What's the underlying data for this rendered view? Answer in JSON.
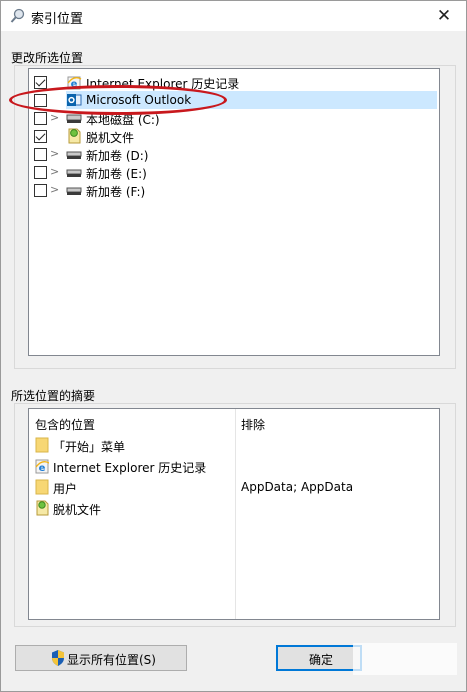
{
  "window": {
    "title": "索引位置",
    "title_icon": "indexing-options-icon",
    "close_glyph": "✕"
  },
  "change_locations": {
    "group_label": "更改所选位置",
    "items": [
      {
        "label": "Internet Explorer 历史记录",
        "checked": true,
        "expandable": false,
        "icon": "internet-explorer-icon"
      },
      {
        "label": "Microsoft Outlook",
        "checked": false,
        "expandable": false,
        "icon": "outlook-icon",
        "selected": true
      },
      {
        "label": "本地磁盘 (C:)",
        "checked": false,
        "expandable": true,
        "icon": "drive-icon"
      },
      {
        "label": "脱机文件",
        "checked": true,
        "expandable": false,
        "icon": "offline-files-icon"
      },
      {
        "label": "新加卷 (D:)",
        "checked": false,
        "expandable": true,
        "icon": "drive-icon"
      },
      {
        "label": "新加卷 (E:)",
        "checked": false,
        "expandable": true,
        "icon": "drive-icon"
      },
      {
        "label": "新加卷 (F:)",
        "checked": false,
        "expandable": true,
        "icon": "drive-icon"
      }
    ]
  },
  "summary": {
    "group_label": "所选位置的摘要",
    "col_included": "包含的位置",
    "col_excluded": "排除",
    "rows": [
      {
        "label": "「开始」菜单",
        "icon": "folder-icon",
        "exclude": ""
      },
      {
        "label": "Internet Explorer 历史记录",
        "icon": "internet-explorer-icon",
        "exclude": ""
      },
      {
        "label": "用户",
        "icon": "folder-icon",
        "exclude": "AppData; AppData"
      },
      {
        "label": "脱机文件",
        "icon": "offline-files-icon",
        "exclude": ""
      }
    ]
  },
  "buttons": {
    "show_all": "显示所有位置(S)",
    "ok": "确定"
  },
  "colors": {
    "selection": "#cce8ff",
    "annotation": "#c8181d",
    "default_button_border": "#0078d7"
  }
}
